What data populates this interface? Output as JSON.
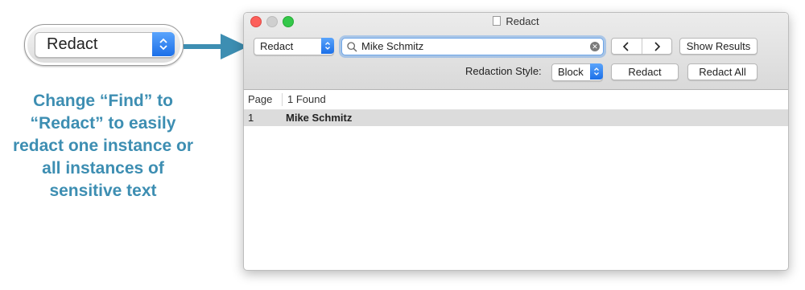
{
  "callout": {
    "popup_label": "Redact",
    "caption": "Change “Find” to “Redact” to easily redact one instance or all instances of sensitive text"
  },
  "window": {
    "title": "Redact",
    "toolbar": {
      "mode_popup_label": "Redact",
      "search_value": "Mike Schmitz",
      "show_results_label": "Show Results",
      "redaction_style_label": "Redaction Style:",
      "style_popup_label": "Block",
      "redact_label": "Redact",
      "redact_all_label": "Redact All"
    },
    "table": {
      "headers": [
        "Page",
        "1 Found"
      ],
      "rows": [
        {
          "page": "1",
          "match": "Mike Schmitz"
        }
      ]
    }
  },
  "icons": [
    "search-icon",
    "clear-search-icon",
    "chevron-left-icon",
    "chevron-right-icon",
    "popup-stepper-icon",
    "document-icon"
  ],
  "colors": {
    "caption": "#3d8eb2",
    "accent_blue": "#1b6fe8",
    "close": "#fc605b",
    "maximize": "#34c84a",
    "selected_row": "#dcdcdc"
  }
}
